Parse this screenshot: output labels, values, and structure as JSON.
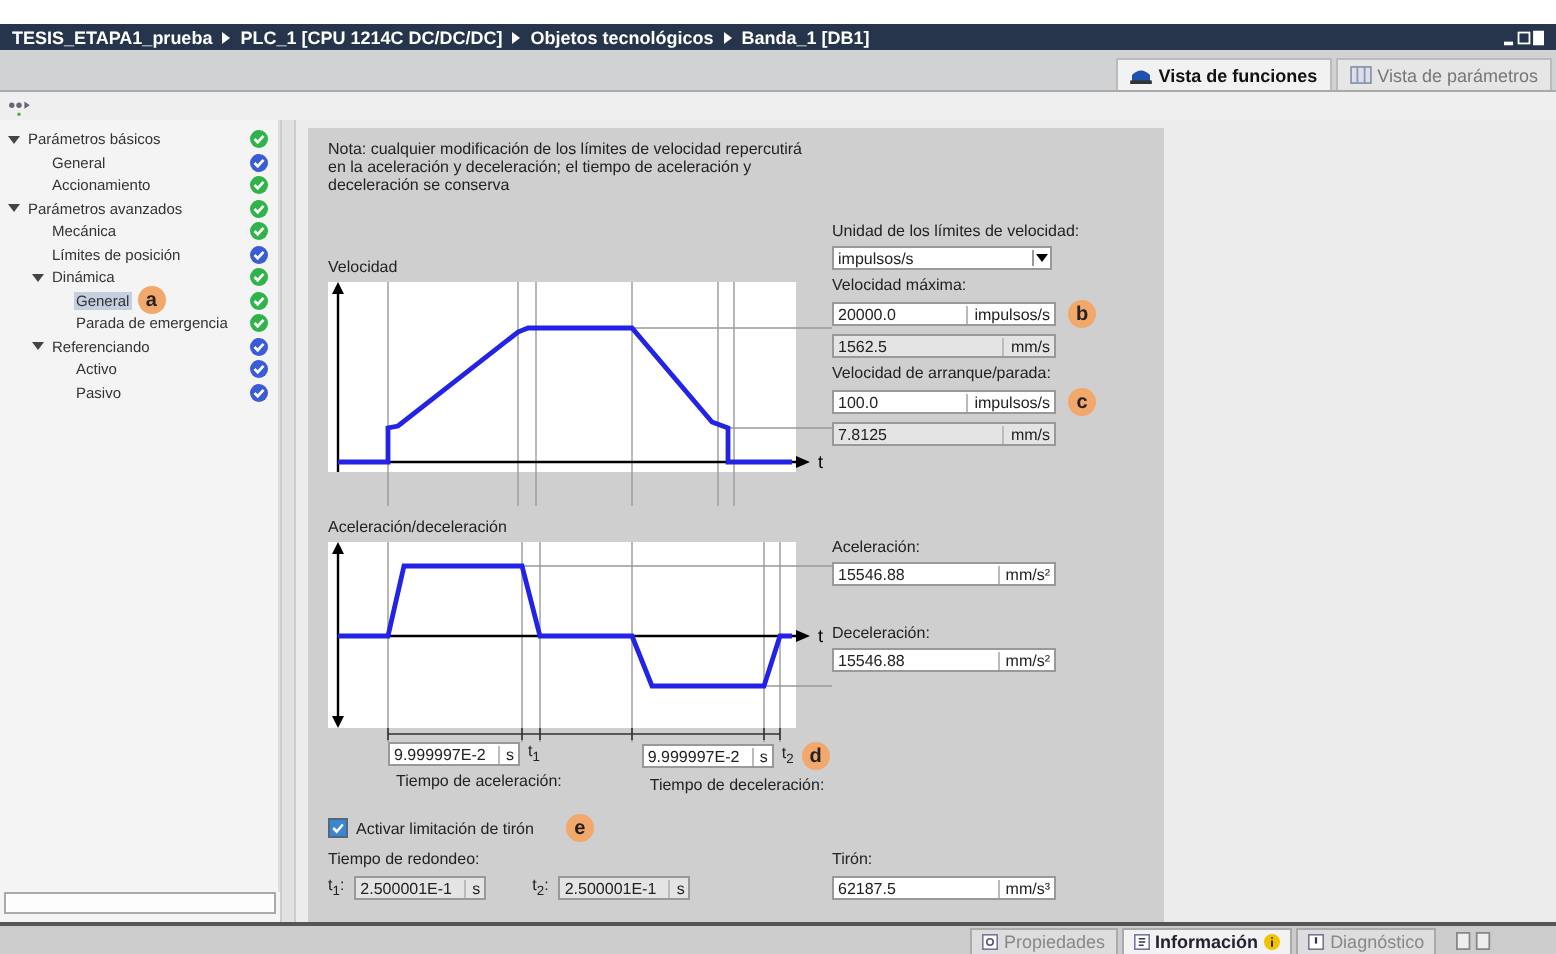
{
  "breadcrumb": [
    "TESIS_ETAPA1_prueba",
    "PLC_1 [CPU 1214C DC/DC/DC]",
    "Objetos tecnológicos",
    "Banda_1 [DB1]"
  ],
  "view_tabs": [
    {
      "label": "Vista de funciones",
      "selected": true
    },
    {
      "label": "Vista de parámetros",
      "selected": false
    }
  ],
  "tree": [
    {
      "label": "Parámetros básicos",
      "expanded": true,
      "selected": false,
      "color": "#2fb34a",
      "children": [
        {
          "label": "General",
          "selected": false,
          "color": "#3a5cd6"
        },
        {
          "label": "Accionamiento",
          "selected": false,
          "color": "#2fb34a"
        }
      ]
    },
    {
      "label": "Parámetros avanzados",
      "expanded": true,
      "selected": false,
      "color": "#2fb34a",
      "children": [
        {
          "label": "Mecánica",
          "selected": false,
          "color": "#2fb34a"
        },
        {
          "label": "Límites de posición",
          "selected": false,
          "color": "#3a5cd6"
        },
        {
          "label": "Dinámica",
          "expanded": true,
          "selected": false,
          "color": "#2fb34a",
          "children": [
            {
              "label": "General",
              "selected": true,
              "color": "#2fb34a",
              "callout": "a"
            },
            {
              "label": "Parada de emergencia",
              "selected": false,
              "color": "#2fb34a"
            }
          ]
        },
        {
          "label": "Referenciando",
          "expanded": true,
          "selected": false,
          "color": "#3a5cd6",
          "children": [
            {
              "label": "Activo",
              "selected": false,
              "color": "#3a5cd6"
            },
            {
              "label": "Pasivo",
              "selected": false,
              "color": "#3a5cd6"
            }
          ]
        }
      ]
    }
  ],
  "note": "Nota: cualquier modificación de los límites de velocidad repercutirá en la aceleración y deceleración; el tiempo de aceleración y deceleración se conserva",
  "velocity": {
    "title": "Velocidad",
    "axis_label": "t",
    "unit_label": "Unidad de los límites de velocidad:",
    "unit_value": "impulsos/s",
    "max_label": "Velocidad máxima:",
    "max_value": "20000.0",
    "max_unit": "impulsos/s",
    "max_callout": "b",
    "max_mm": "1562.5",
    "max_mm_unit": "mm/s",
    "start_label": "Velocidad de arranque/parada:",
    "start_value": "100.0",
    "start_unit": "impulsos/s",
    "start_callout": "c",
    "start_mm": "7.8125",
    "start_mm_unit": "mm/s"
  },
  "acceleration": {
    "title": "Aceleración/deceleración",
    "axis_label": "t",
    "accel_label": "Aceleración:",
    "accel_value": "15546.88",
    "accel_unit": "mm/s²",
    "decel_label": "Deceleración:",
    "decel_value": "15546.88",
    "decel_unit": "mm/s²",
    "accel_time": "9.999997E-2",
    "accel_time_unit": "s",
    "t1": "t$_{1}$",
    "accel_time_label": "Tiempo de aceleración:",
    "decel_time": "9.999997E-2",
    "decel_time_unit": "s",
    "t2": "t$_{2}$",
    "decel_time_label": "Tiempo de deceleración:",
    "callout": "d"
  },
  "jerk": {
    "checkbox_label": "Activar limitación de tirón",
    "checked": true,
    "callout": "e",
    "rounding_label": "Tiempo de redondeo:",
    "t1_label": "t$_{1}$:",
    "t1_value": "2.500001E-1",
    "t1_unit": "s",
    "t2_label": "t$_{2}$:",
    "t2_value": "2.500001E-1",
    "t2_unit": "s",
    "jerk_label": "Tirón:",
    "jerk_value": "62187.5",
    "jerk_unit": "mm/s³"
  },
  "bottom_tabs": [
    {
      "label": "Propiedades",
      "selected": false
    },
    {
      "label": "Información",
      "selected": true
    },
    {
      "label": "Diagnóstico",
      "selected": false
    }
  ]
}
